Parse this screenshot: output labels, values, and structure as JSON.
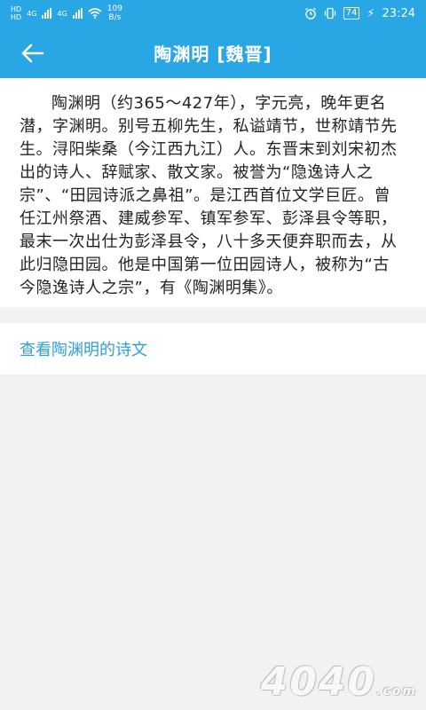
{
  "status_bar": {
    "left_badges": [
      "HD",
      "HD"
    ],
    "network_labels": [
      "4G",
      "4G"
    ],
    "speed_value": "109",
    "speed_unit": "B/s",
    "battery": "74",
    "time": "23:24",
    "icons": [
      "alarm-icon",
      "vibrate-icon",
      "battery-icon",
      "charging-icon",
      "wifi-icon",
      "signal-icon"
    ]
  },
  "header": {
    "title": "陶渊明 [魏晋]",
    "back_icon": "back-arrow-icon"
  },
  "bio": {
    "text": "陶渊明（约365～427年），字元亮，晚年更名潜，字渊明。别号五柳先生，私谥靖节，世称靖节先生。浔阳柴桑（今江西九江）人。东晋末到刘宋初杰出的诗人、辞赋家、散文家。被誉为“隐逸诗人之宗”、“田园诗派之鼻祖”。是江西首位文学巨匠。曾任江州祭酒、建威参军、镇军参军、彭泽县令等职，最末一次出仕为彭泽县令，八十多天便弃职而去，从此归隐田园。他是中国第一位田园诗人，被称为“古今隐逸诗人之宗”，有《陶渊明集》。"
  },
  "poems_link": {
    "label": "查看陶渊明的诗文"
  },
  "watermark": {
    "text": "4040",
    "suffix": ".com"
  },
  "colors": {
    "header_bg": "#29a6e4",
    "link": "#2ea0d8",
    "page_bg": "#f2f2f2"
  }
}
